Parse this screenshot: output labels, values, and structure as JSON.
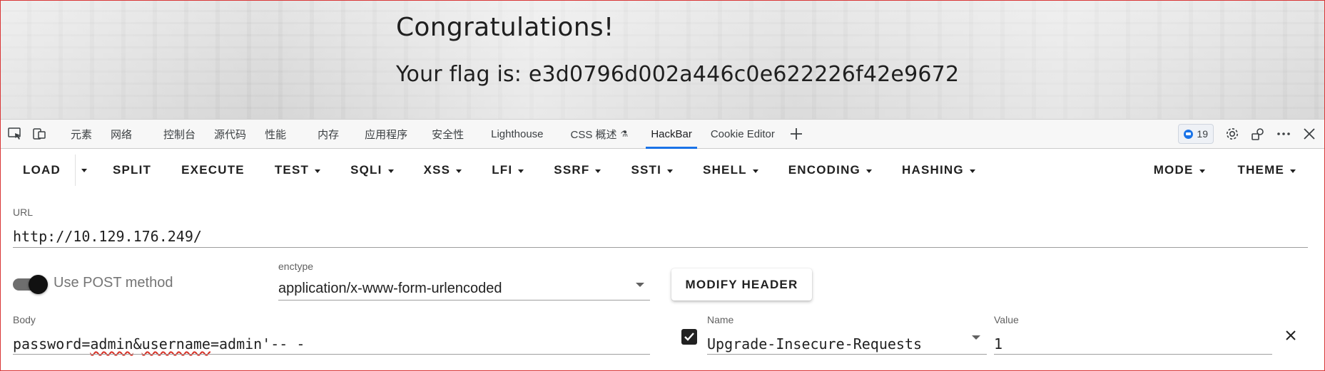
{
  "page": {
    "heading": "Congratulations!",
    "flag_text": "Your flag is: e3d0796d002a446c0e622226f42e9672"
  },
  "devtools": {
    "tabs": [
      "元素",
      "网络",
      "控制台",
      "源代码",
      "性能",
      "内存",
      "应用程序",
      "安全性",
      "Lighthouse",
      "CSS 概述",
      "HackBar",
      "Cookie Editor"
    ],
    "active_tab": "HackBar",
    "issues_count": "19",
    "icons": [
      "inspect-icon",
      "device-toolbar-icon",
      "add-tab-icon",
      "settings-icon",
      "customize-icon",
      "more-icon",
      "close-icon"
    ]
  },
  "hackbar": {
    "menu": {
      "load": "LOAD",
      "split": "SPLIT",
      "execute": "EXECUTE",
      "test": "TEST",
      "sqli": "SQLI",
      "xss": "XSS",
      "lfi": "LFI",
      "ssrf": "SSRF",
      "ssti": "SSTI",
      "shell": "SHELL",
      "encoding": "ENCODING",
      "hashing": "HASHING",
      "mode": "MODE",
      "theme": "THEME"
    },
    "url_label": "URL",
    "url_value": "http://10.129.176.249/",
    "post_toggle_label": "Use POST method",
    "post_enabled": true,
    "enctype_label": "enctype",
    "enctype_value": "application/x-www-form-urlencoded",
    "modify_header_label": "MODIFY HEADER",
    "body_label": "Body",
    "body_value_parts": [
      "password=",
      "admin",
      "&",
      "username",
      "=admin'-- -"
    ],
    "header_name_label": "Name",
    "header_name_value": "Upgrade-Insecure-Requests",
    "header_value_label": "Value",
    "header_value_value": "1",
    "header_enabled": true
  },
  "colors": {
    "accent": "#1a73e8",
    "frame": "#d93636",
    "spellcheck": "#d93025"
  }
}
